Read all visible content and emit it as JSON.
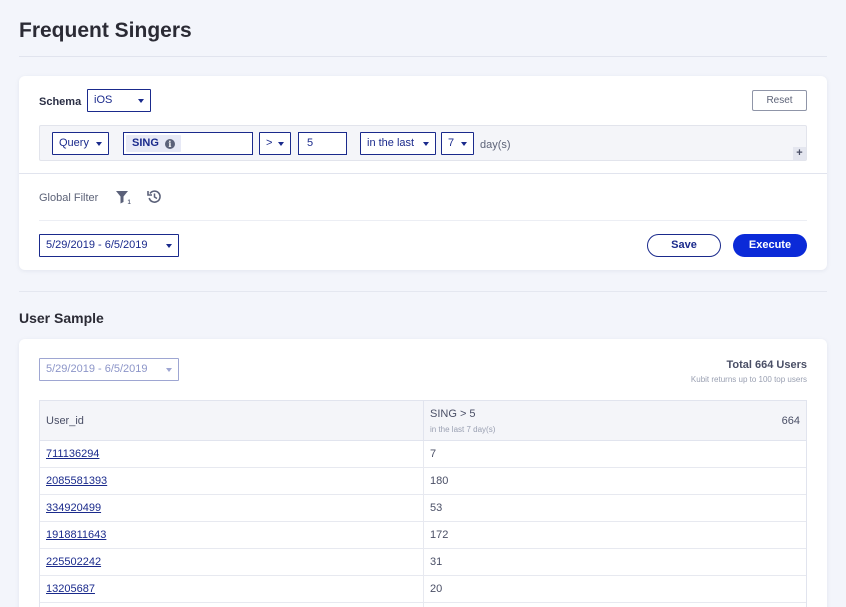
{
  "page": {
    "title": "Frequent Singers"
  },
  "query": {
    "schema_label": "Schema",
    "schema_value": "iOS",
    "reset_label": "Reset",
    "metric_type": "Query",
    "event": "SING",
    "operator": ">",
    "value": "5",
    "time_mode": "in the last",
    "period": "7",
    "period_unit": "day(s)",
    "add_symbol": "+",
    "global_filter_label": "Global Filter",
    "filter_count": "1",
    "date_range": "5/29/2019 - 6/5/2019",
    "save_label": "Save",
    "execute_label": "Execute"
  },
  "sample": {
    "title": "User Sample",
    "date_range": "5/29/2019 - 6/5/2019",
    "total": "Total 664 Users",
    "note": "Kubit returns up to 100 top users",
    "columns": {
      "user_id": "User_id",
      "metric": "SING > 5",
      "metric_sub": "in the last 7 day(s)",
      "metric_total": "664"
    },
    "rows": [
      {
        "id": "711136294",
        "value": "7"
      },
      {
        "id": "2085581393",
        "value": "180"
      },
      {
        "id": "334920499",
        "value": "53"
      },
      {
        "id": "1918811643",
        "value": "172"
      },
      {
        "id": "225502242",
        "value": "31"
      },
      {
        "id": "13205687",
        "value": "20"
      },
      {
        "id": "",
        "value": ""
      }
    ]
  },
  "colors": {
    "accent": "#0b2ad8",
    "navy": "#1a2a8c",
    "background": "#f3f5fb"
  }
}
